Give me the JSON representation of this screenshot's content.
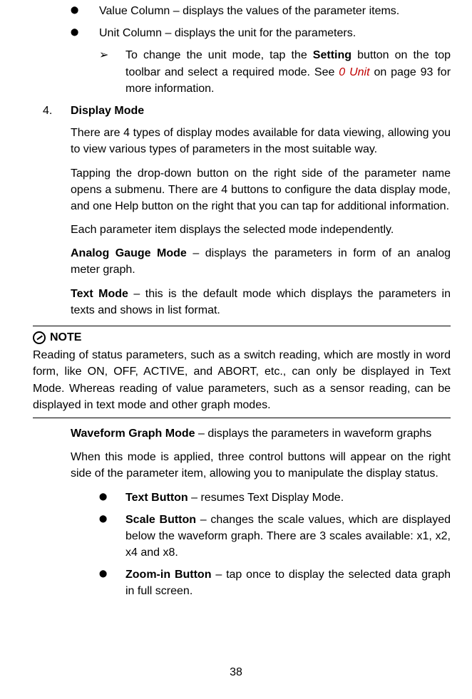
{
  "bullets_top": [
    "Value Column – displays the values of the parameter items.",
    "Unit Column – displays the unit for the parameters."
  ],
  "unit_change": {
    "prefix": "To change the unit mode, tap the ",
    "bold1": "Setting",
    "mid": " button on the top toolbar and select a required mode. See ",
    "link": "0 Unit",
    "suffix": " on page 93 for more information."
  },
  "section4": {
    "num": "4.",
    "title": "Display Mode",
    "p1": "There are 4 types of display modes available for data viewing, allowing you to view various types of parameters in the most suitable way.",
    "p2": "Tapping the drop-down button on the right side of the parameter name opens a submenu. There are 4 buttons to configure the data display mode, and one Help button on the right that you can tap for additional information.",
    "p3": "Each parameter item displays the selected mode independently.",
    "analog_b": "Analog Gauge Mode",
    "analog_t": " – displays the parameters in form of an analog meter graph.",
    "text_b": "Text Mode",
    "text_t": " – this is the default mode which displays the parameters in texts and shows in list format."
  },
  "note": {
    "head": "NOTE",
    "body": "Reading of status parameters, such as a switch reading, which are mostly in word form, like ON, OFF, ACTIVE, and ABORT, etc., can only be displayed in Text Mode. Whereas reading of value parameters, such as a sensor reading, can be displayed in text mode and other graph modes."
  },
  "waveform": {
    "head_b": "Waveform Graph Mode",
    "head_t": " – displays the parameters in waveform graphs",
    "p": "When this mode is applied, three control buttons will appear on the right side of the parameter item, allowing you to manipulate the display status.",
    "items": [
      {
        "b": "Text Button",
        "t": " – resumes Text Display Mode."
      },
      {
        "b": "Scale Button",
        "t": " – changes the scale values, which are displayed below the waveform graph. There are 3 scales available: x1, x2, x4 and x8."
      },
      {
        "b": "Zoom-in Button",
        "t": " – tap once to display the selected data graph in full screen."
      }
    ]
  },
  "page_number": "38"
}
